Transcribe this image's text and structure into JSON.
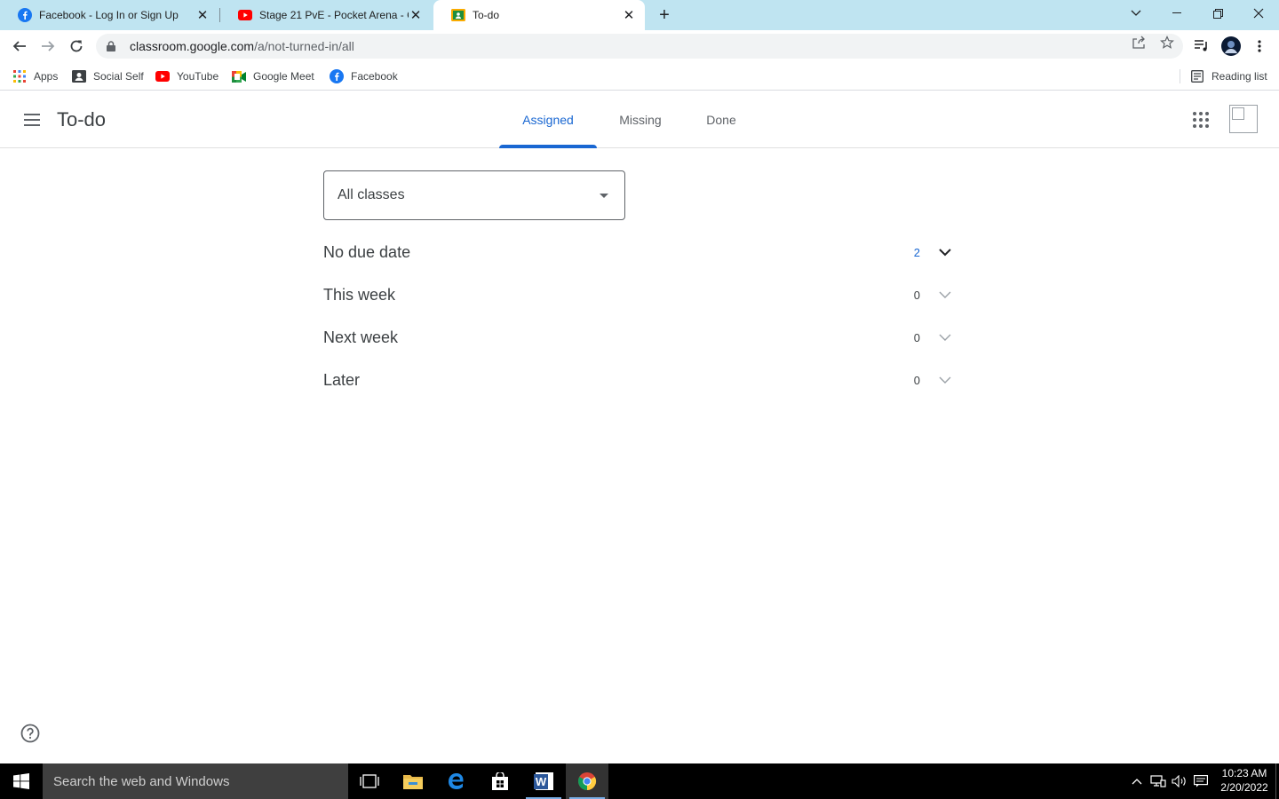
{
  "browser": {
    "tabs": [
      {
        "title": "Facebook - Log In or Sign Up",
        "favicon": "facebook-icon",
        "active": false
      },
      {
        "title": "Stage 21 PvE - Pocket Arena - Ca",
        "favicon": "youtube-icon",
        "active": false
      },
      {
        "title": "To-do",
        "favicon": "classroom-icon",
        "active": true
      }
    ],
    "url_host": "classroom.google.com",
    "url_path": "/a/not-turned-in/all",
    "bookmarks": [
      {
        "label": "Apps",
        "icon": "apps-grid-icon"
      },
      {
        "label": "Social Self",
        "icon": "contact-card-icon"
      },
      {
        "label": "YouTube",
        "icon": "youtube-icon"
      },
      {
        "label": "Google Meet",
        "icon": "google-meet-icon"
      },
      {
        "label": "Facebook",
        "icon": "facebook-icon"
      }
    ],
    "reading_list_label": "Reading list"
  },
  "header": {
    "title": "To-do",
    "tabs": [
      {
        "label": "Assigned",
        "active": true
      },
      {
        "label": "Missing",
        "active": false
      },
      {
        "label": "Done",
        "active": false
      }
    ]
  },
  "main": {
    "class_filter": "All classes",
    "sections": [
      {
        "label": "No due date",
        "count": "2",
        "expanded": true
      },
      {
        "label": "This week",
        "count": "0",
        "expanded": false
      },
      {
        "label": "Next week",
        "count": "0",
        "expanded": false
      },
      {
        "label": "Later",
        "count": "0",
        "expanded": false
      }
    ]
  },
  "taskbar": {
    "search_placeholder": "Search the web and Windows",
    "clock_time": "10:23 AM",
    "clock_date": "2/20/2022"
  },
  "colors": {
    "accent": "#1967d2",
    "tabbar": "#bfe4f1",
    "taskbar": "#000000"
  }
}
